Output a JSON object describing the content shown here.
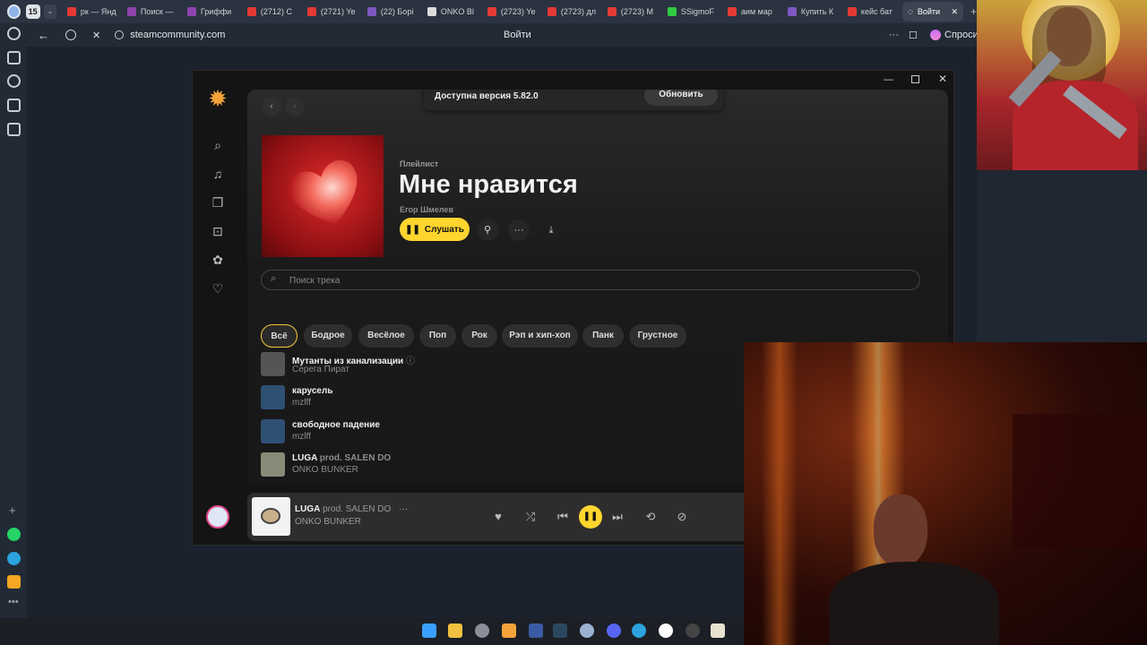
{
  "browser": {
    "tab_count": "15",
    "tabs": [
      {
        "label": "рк — Янд",
        "color": "#e53935"
      },
      {
        "label": "Поиск —",
        "color": "#8e44ad"
      },
      {
        "label": "Гриффи",
        "color": "#8e44ad"
      },
      {
        "label": "(2712) С",
        "color": "#e53935"
      },
      {
        "label": "(2721) Ye",
        "color": "#e53935"
      },
      {
        "label": "(22) Борі",
        "color": "#7e57c2"
      },
      {
        "label": "ONKO Bl",
        "color": "#dddddd"
      },
      {
        "label": "(2723) Ye",
        "color": "#e53935"
      },
      {
        "label": "(2723) дл",
        "color": "#e53935"
      },
      {
        "label": "(2723) M",
        "color": "#e53935"
      },
      {
        "label": "SSigmoF",
        "color": "#2ecc40"
      },
      {
        "label": "аим мар",
        "color": "#e53935"
      },
      {
        "label": "Купить К",
        "color": "#7e57c2"
      },
      {
        "label": "кейс бат",
        "color": "#e53935"
      }
    ],
    "active_tab": "Войти",
    "url": "steamcommunity.com",
    "page_title": "Войти",
    "ask_label": "Спроси"
  },
  "app": {
    "update_text": "Доступна версия 5.82.0",
    "update_button": "Обновить",
    "playlist_type": "Плейлист",
    "playlist_title": "Мне нравится",
    "owner": "Егор Шмелев",
    "listen_button": "Слушать",
    "search_placeholder": "Поиск трека",
    "chips": [
      "Всё",
      "Бодрое",
      "Весёлое",
      "Поп",
      "Рок",
      "Рэп и хип-хоп",
      "Панк",
      "Грустное"
    ],
    "tracks": [
      {
        "title": "Мутанты из канализации",
        "feat": "",
        "artist": "Серега Пират",
        "thumb": "#5a5a5a"
      },
      {
        "title": "карусель",
        "feat": "",
        "artist": "mzlff",
        "thumb": "#2f4f73"
      },
      {
        "title": "свободное падение",
        "feat": "",
        "artist": "mzlff",
        "thumb": "#2f4f73"
      },
      {
        "title": "LUGA",
        "feat": "prod. SALEN DO",
        "artist": "ONKO BUNKER",
        "thumb": "#8a8a78"
      }
    ],
    "player": {
      "title": "LUGA",
      "feat": "prod. SALEN DO",
      "artist": "ONKO BUNKER"
    }
  }
}
